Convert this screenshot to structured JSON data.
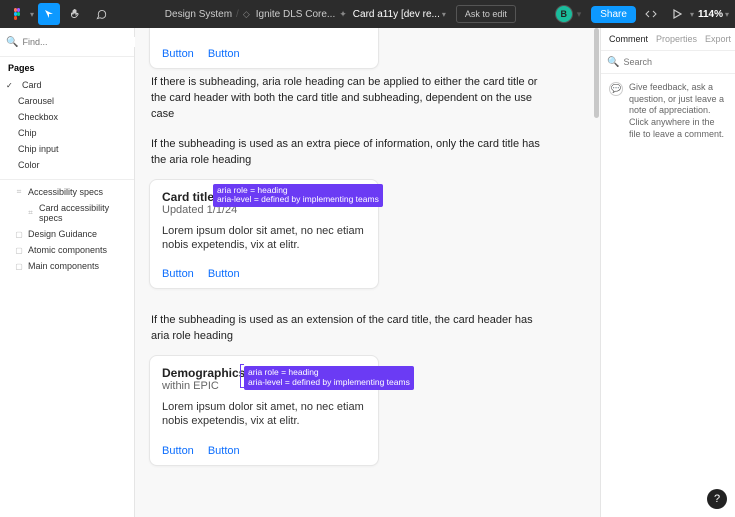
{
  "toolbar": {
    "breadcrumb_root": "Design System",
    "breadcrumb_proj": "Ignite DLS Core...",
    "breadcrumb_file": "Card a11y [dev re...",
    "ask_edit": "Ask to edit",
    "avatar_letter": "B",
    "share": "Share",
    "zoom": "114%"
  },
  "left": {
    "search_placeholder": "Find...",
    "filter_label": "Card",
    "pages_header": "Pages",
    "pages": [
      "Card",
      "Carousel",
      "Checkbox",
      "Chip",
      "Chip input",
      "Color"
    ],
    "layers": [
      "Accessibility specs",
      "Card accessibility specs",
      "Design Guidance",
      "Atomic components",
      "Main components"
    ]
  },
  "right": {
    "tabs": [
      "Comment",
      "Properties",
      "Export"
    ],
    "search_placeholder": "Search",
    "hint": "Give feedback, ask a question, or just leave a note of appreciation. Click anywhere in the file to leave a comment."
  },
  "canvas": {
    "top_card": {
      "button1": "Button",
      "button2": "Button"
    },
    "para1": "If there is subheading, aria role heading can be applied to either the card title or the card header with both the card title and subheading, dependent on the use case",
    "para2": "If the subheading is used as an extra piece of information, only the card title has the aria role heading",
    "card2": {
      "title": "Card title",
      "subtitle": "Updated 1/1/24",
      "body": "Lorem ipsum dolor sit amet, no nec etiam nobis expetendis, vix at elitr.",
      "button1": "Button",
      "button2": "Button",
      "annotation_l1": "aria role = heading",
      "annotation_l2": "aria-level = defined by implementing teams"
    },
    "para3": "If the subheading is used as an extension of the card title, the card header has aria role heading",
    "card3": {
      "title": "Demographics",
      "subtitle": "within EPIC",
      "body": "Lorem ipsum dolor sit amet, no nec etiam nobis expetendis, vix at elitr.",
      "button1": "Button",
      "button2": "Button",
      "annotation_l1": "aria role = heading",
      "annotation_l2": "aria-level = defined by implementing teams"
    }
  }
}
